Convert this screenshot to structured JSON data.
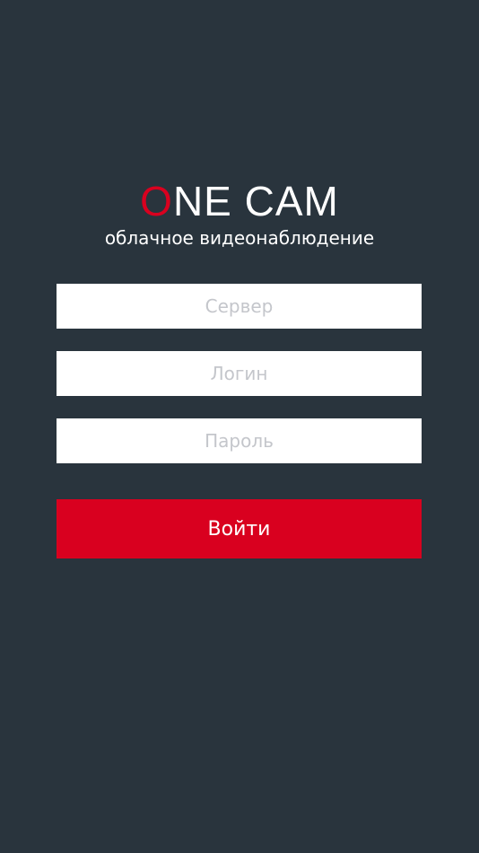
{
  "brand": {
    "logo_first_letter": "O",
    "logo_rest": "NE CAM",
    "tagline": "облачное видеонаблюдение",
    "accent_color": "#d9001f",
    "background_color": "#29343d"
  },
  "form": {
    "server_placeholder": "Сервер",
    "login_placeholder": "Логин",
    "password_placeholder": "Пароль",
    "submit_label": "Войти"
  }
}
